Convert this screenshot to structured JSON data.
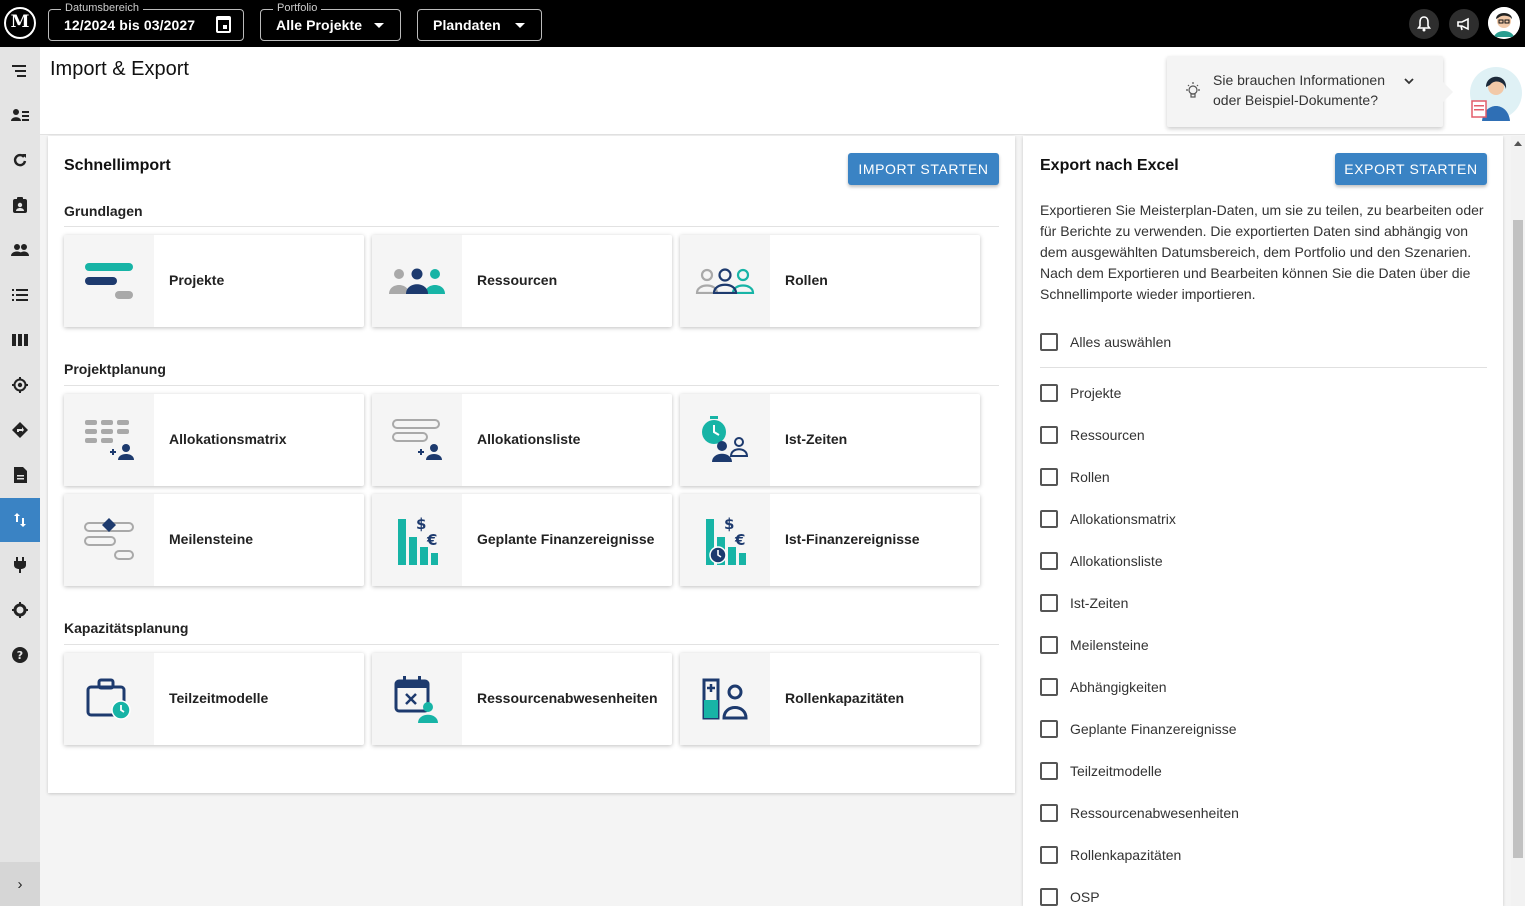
{
  "topbar": {
    "logo": "M",
    "date_range": {
      "legend": "Datumsbereich",
      "value": "12/2024 bis 03/2027"
    },
    "portfolio": {
      "legend": "Portfolio",
      "value": "Alle Projekte"
    },
    "scenario": {
      "value": "Plandaten"
    },
    "icons": [
      "bell-icon",
      "megaphone-icon",
      "user-avatar"
    ]
  },
  "sidebar": {
    "items": [
      "menu-icon",
      "resource-list-icon",
      "refresh-icon",
      "badge-icon",
      "people-icon",
      "list-icon",
      "columns-icon",
      "target-icon",
      "route-icon",
      "document-icon",
      "import-export-icon",
      "plug-icon",
      "settings-icon",
      "help-icon"
    ],
    "active": "import-export-icon",
    "expand": "›"
  },
  "header": {
    "title": "Import & Export",
    "help": {
      "text": "Sie brauchen Informationen oder Beispiel-Dokumente?"
    }
  },
  "import": {
    "title": "Schnellimport",
    "button": "IMPORT STARTEN",
    "sections": [
      {
        "title": "Grundlagen",
        "tiles": [
          "Projekte",
          "Ressourcen",
          "Rollen"
        ]
      },
      {
        "title": "Projektplanung",
        "tiles": [
          "Allokationsmatrix",
          "Allokationsliste",
          "Ist-Zeiten",
          "Meilensteine",
          "Geplante Finanzereignisse",
          "Ist-Finanzereignisse"
        ]
      },
      {
        "title": "Kapazitätsplanung",
        "tiles": [
          "Teilzeitmodelle",
          "Ressourcenabwesenheiten",
          "Rollenkapazitäten"
        ]
      }
    ]
  },
  "export": {
    "title": "Export nach Excel",
    "button": "EXPORT STARTEN",
    "description": "Exportieren Sie Meisterplan-Daten, um sie zu teilen, zu bearbeiten oder für Berichte zu verwenden. Die exportierten Daten sind abhängig von dem ausgewählten Datumsbereich, dem Portfolio und den Szenarien. Nach dem Exportieren und Bearbeiten können Sie die Daten über die Schnellimporte wieder importieren.",
    "select_all": "Alles auswählen",
    "options": [
      "Projekte",
      "Ressourcen",
      "Rollen",
      "Allokationsmatrix",
      "Allokationsliste",
      "Ist-Zeiten",
      "Meilensteine",
      "Abhängigkeiten",
      "Geplante Finanzereignisse",
      "Teilzeitmodelle",
      "Ressourcenabwesenheiten",
      "Rollenkapazitäten",
      "OSP"
    ]
  },
  "colors": {
    "accent": "#3a83c4",
    "teal": "#17b4a6",
    "navy": "#1d3a6e",
    "grey": "#a9a9a9"
  }
}
